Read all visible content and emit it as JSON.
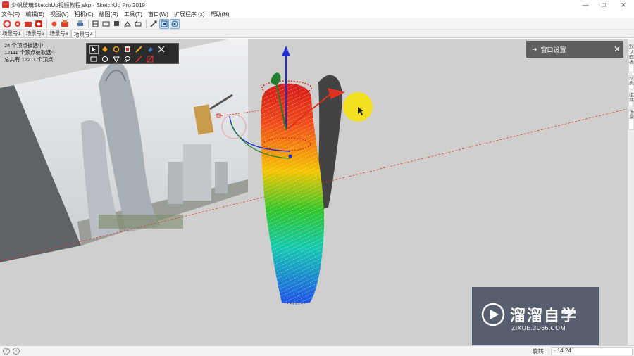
{
  "window": {
    "title": "少帆玻璃SketchUp视频教程.skp - SketchUp Pro 2019",
    "minimize": "—",
    "maximize": "□",
    "close": "✕"
  },
  "menu": [
    "文件(F)",
    "编辑(E)",
    "视图(V)",
    "相机(C)",
    "绘图(R)",
    "工具(T)",
    "窗口(W)",
    "扩展程序 (x)",
    "帮助(H)"
  ],
  "scene_tabs": [
    {
      "label": "场景号1",
      "active": false
    },
    {
      "label": "场景号3",
      "active": false
    },
    {
      "label": "场景号8",
      "active": false
    },
    {
      "label": "场景号4",
      "active": true
    }
  ],
  "overlay": {
    "line1": "24 个顶点被选中",
    "line2": "12111 个顶点被软选中",
    "line3": "总共有 12211 个顶点"
  },
  "panel": {
    "arrow": "➜",
    "title": "窗口设置",
    "close": "✕"
  },
  "right_strip": [
    "默认面板",
    "材质",
    "组件",
    "场景"
  ],
  "watermark": {
    "title": "溜溜自学",
    "subtitle": "ZIXUE.3D66.COM"
  },
  "status": {
    "measure_label": "旋转",
    "measure_value": "- 14.24"
  },
  "colors": {
    "viewport_bg": "#cfcfcd",
    "cursor_highlight": "#f2df22",
    "axis_red": "#e03020",
    "axis_green": "#208030",
    "axis_blue": "#2030d0",
    "panel_bg": "#5f5f5f"
  }
}
